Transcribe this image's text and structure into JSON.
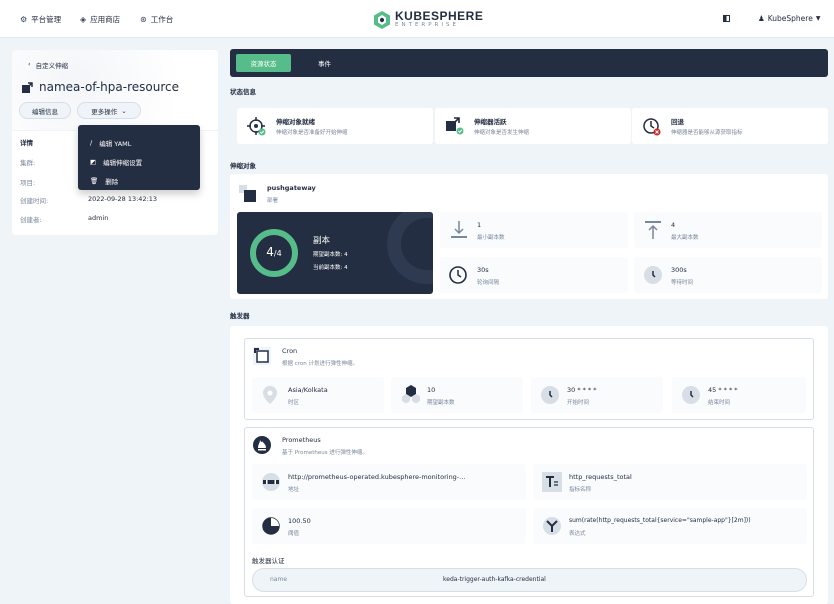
{
  "topbar": {
    "nav": [
      {
        "label": "平台管理",
        "icon": "platform-icon"
      },
      {
        "label": "应用商店",
        "icon": "app-store-icon"
      },
      {
        "label": "工作台",
        "icon": "workbench-icon"
      }
    ],
    "logo_title": "KUBESPHERE",
    "logo_sub": "ENTERPRISE",
    "user": "KubeSphere"
  },
  "left": {
    "back_label": "自定义伸缩",
    "name": "namea-of-hpa-resource",
    "edit_info": "编辑信息",
    "more_actions": "更多操作",
    "details_heading": "详情",
    "details": [
      {
        "label": "集群:",
        "value": ""
      },
      {
        "label": "项目:",
        "value": ""
      },
      {
        "label": "创建时间:",
        "value": "2022-09-28 13:42:13"
      },
      {
        "label": "创建者:",
        "value": "admin"
      }
    ],
    "menu": [
      "编辑 YAML",
      "编辑伸缩设置",
      "删除"
    ]
  },
  "tabs": [
    "资源状态",
    "事件"
  ],
  "status": {
    "title": "状态信息",
    "items": [
      {
        "title": "伸缩对象就绪",
        "desc": "伸缩对象是否准备好开始伸缩",
        "status_color": "#55bc8a"
      },
      {
        "title": "伸缩器活跃",
        "desc": "伸缩对象是否发生伸缩",
        "status_color": "#55bc8a"
      },
      {
        "title": "回退",
        "desc": "伸缩器是否能够从源获取指标",
        "status_color": "#ca2621"
      }
    ]
  },
  "target": {
    "title": "伸缩对象",
    "name": "pushgateway",
    "kind": "部署",
    "ring_current": "4",
    "ring_total": "4",
    "replica_label": "副本",
    "desired": "期望副本数: 4",
    "current": "当前副本数: 4",
    "stats": [
      {
        "value": "1",
        "label": "最小副本数"
      },
      {
        "value": "4",
        "label": "最大副本数"
      },
      {
        "value": "30s",
        "label": "轮询间隔"
      },
      {
        "value": "300s",
        "label": "等待时间"
      }
    ]
  },
  "triggers": {
    "title": "触发器",
    "cron": {
      "name": "Cron",
      "desc": "根据 cron 计划进行弹性伸缩。",
      "cells": [
        {
          "value": "Asia/Kolkata",
          "label": "时区"
        },
        {
          "value": "10",
          "label": "期望副本数"
        },
        {
          "value": "30 * * * *",
          "label": "开始时间"
        },
        {
          "value": "45 * * * *",
          "label": "结束时间"
        }
      ]
    },
    "prometheus": {
      "name": "Prometheus",
      "desc": "基于 Prometheus 进行弹性伸缩。",
      "cells": [
        {
          "value": "http://prometheus-operated.kubesphere-monitoring-...",
          "label": "地址"
        },
        {
          "value": "http_requests_total",
          "label": "指标名称"
        },
        {
          "value": "100.50",
          "label": "阈值"
        },
        {
          "value": "sum(rate(http_requests_total{service=\"sample-app\"}[2m]))",
          "label": "表达式"
        }
      ],
      "auth_title": "触发器认证",
      "auth_key": "name",
      "auth_value": "keda-trigger-auth-kafka-credential"
    }
  },
  "colors": {
    "accent": "#55bc8a",
    "dark": "#242e42",
    "danger": "#ca2621"
  }
}
